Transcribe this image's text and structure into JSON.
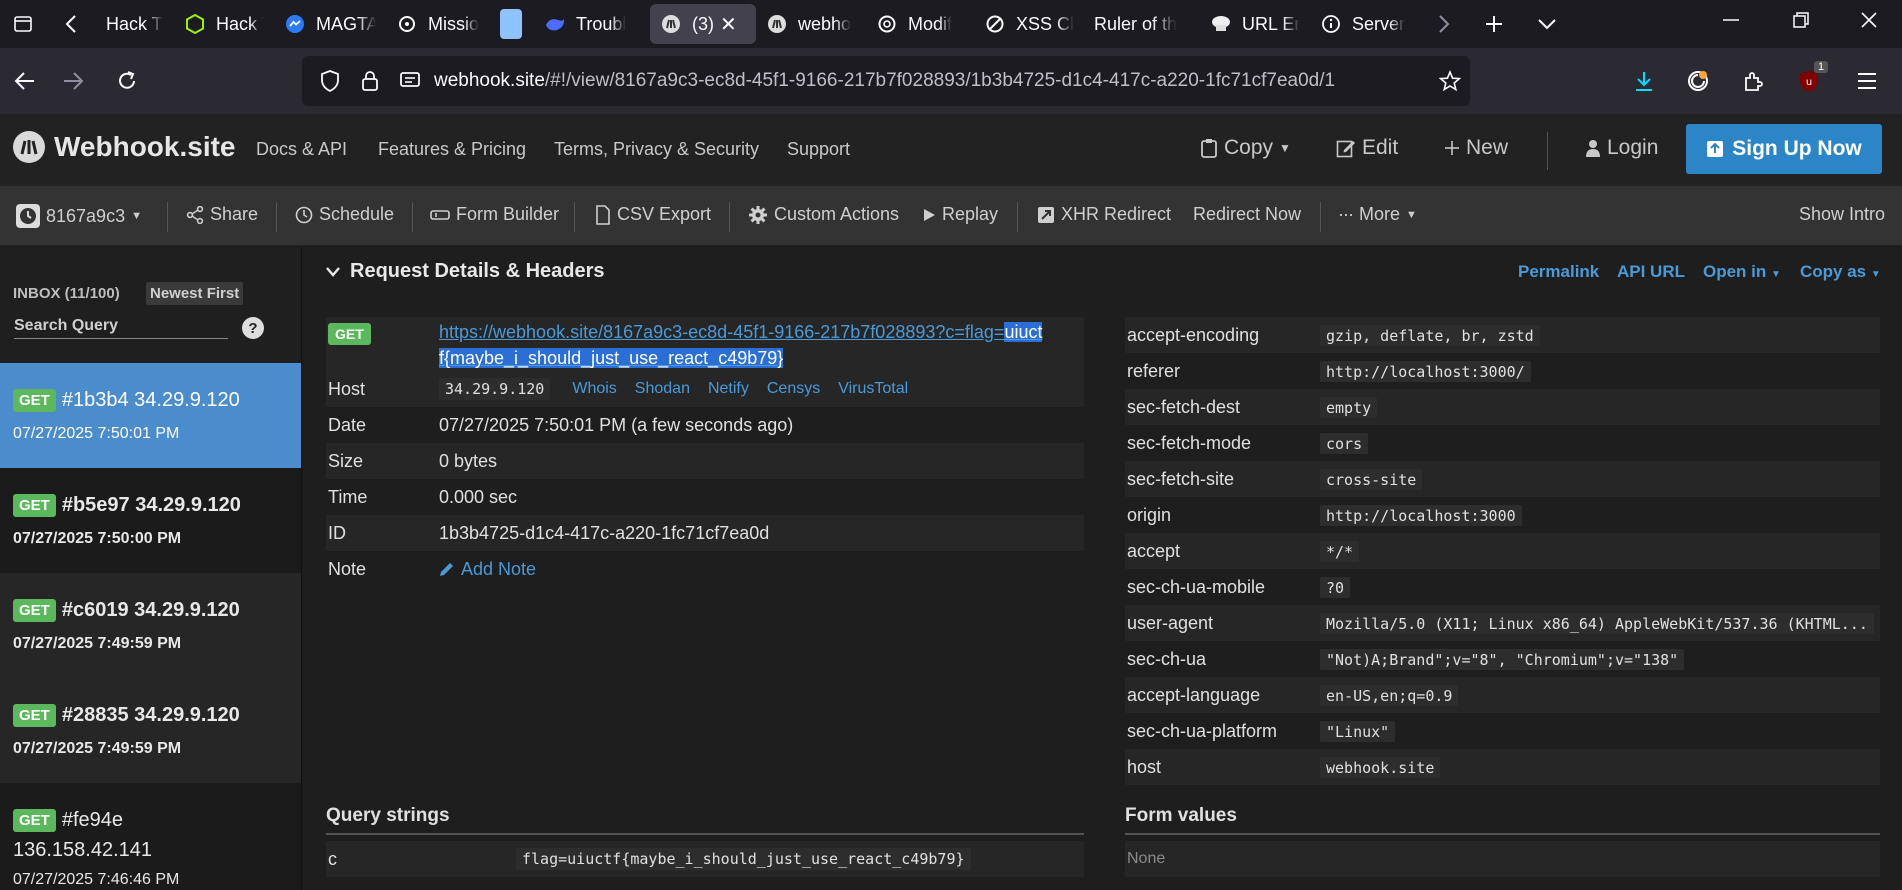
{
  "browser": {
    "tabs": [
      {
        "label": "Hack T",
        "icon": "hackthebox-icon"
      },
      {
        "label": "Hack T",
        "icon": "hackthebox-green-icon"
      },
      {
        "label": "MAGTA",
        "icon": "messenger-icon"
      },
      {
        "label": "Missio",
        "icon": "mission-icon"
      },
      {
        "label": "",
        "icon": "blank-page-icon"
      },
      {
        "label": "Troubl",
        "icon": "deepseek-icon"
      },
      {
        "label": "(3)",
        "icon": "webhook-icon"
      },
      {
        "label": "webho",
        "icon": "webhook-icon"
      },
      {
        "label": "Modif",
        "icon": "chatgpt-icon"
      },
      {
        "label": "XSS Cl",
        "icon": "xss-icon"
      },
      {
        "label": "Ruler of th",
        "icon": ""
      },
      {
        "label": "URL Er",
        "icon": "chef-hat-icon"
      },
      {
        "label": "Server",
        "icon": "info-circle-icon"
      }
    ],
    "url": {
      "domain": "webhook.site",
      "path": "/#!/view/8167a9c3-ec8d-45f1-9166-217b7f028893/1b3b4725-d1c4-417c-a220-1fc71cf7ea0d/1"
    },
    "extension_badge": "1",
    "accent_color": "#00ddff"
  },
  "header": {
    "brand": "Webhook.site",
    "links": [
      "Docs & API",
      "Features & Pricing",
      "Terms, Privacy & Security",
      "Support"
    ],
    "copy_label": "Copy",
    "edit_label": "Edit",
    "new_label": "New",
    "login_label": "Login",
    "signup_label": "Sign Up Now",
    "signup_color": "#2c85c6"
  },
  "toolbar": {
    "token": "8167a9c3",
    "share": "Share",
    "schedule": "Schedule",
    "form_builder": "Form Builder",
    "csv_export": "CSV Export",
    "custom_actions": "Custom Actions",
    "replay": "Replay",
    "xhr_redirect": "XHR Redirect",
    "redirect_now": "Redirect Now",
    "more": "More",
    "show_intro": "Show Intro"
  },
  "sidebar": {
    "inbox": "INBOX (11/100)",
    "sort": "Newest First",
    "search_placeholder": "Search Query",
    "help": "?",
    "requests": [
      {
        "method": "GET",
        "id_ip": "#1b3b4 34.29.9.120",
        "time": "07/27/2025 7:50:01 PM",
        "active": true
      },
      {
        "method": "GET",
        "id_ip": "#b5e97 34.29.9.120",
        "time": "07/27/2025 7:50:00 PM"
      },
      {
        "method": "GET",
        "id_ip": "#c6019 34.29.9.120",
        "time": "07/27/2025 7:49:59 PM"
      },
      {
        "method": "GET",
        "id_ip": "#28835 34.29.9.120",
        "time": "07/27/2025 7:49:59 PM"
      },
      {
        "method": "GET",
        "id": "#fe94e",
        "ip": "136.158.42.141",
        "time": "07/27/2025 7:46:46 PM"
      }
    ]
  },
  "details": {
    "title": "Request Details & Headers",
    "actions": [
      "Permalink",
      "API URL",
      "Open in",
      "Copy as"
    ],
    "method": "GET",
    "url_part1": "https://webhook.site/8167a9c3-ec8d-45f1-9166-217b7f028893?c=flag=",
    "url_hl1": "uiuct",
    "url_hl2": "f{maybe_i_should_just_use_react_c49b79}",
    "rows": {
      "host_label": "Host",
      "host": "34.29.9.120",
      "host_links": [
        "Whois",
        "Shodan",
        "Netify",
        "Censys",
        "VirusTotal"
      ],
      "date_label": "Date",
      "date": "07/27/2025 7:50:01 PM (a few seconds ago)",
      "size_label": "Size",
      "size": "0 bytes",
      "time_label": "Time",
      "time": "0.000 sec",
      "id_label": "ID",
      "id": "1b3b4725-d1c4-417c-a220-1fc71cf7ea0d",
      "note_label": "Note",
      "note": "Add Note"
    },
    "headers": [
      {
        "k": "accept-encoding",
        "v": "gzip, deflate, br, zstd"
      },
      {
        "k": "referer",
        "v": "http://localhost:3000/"
      },
      {
        "k": "sec-fetch-dest",
        "v": "empty"
      },
      {
        "k": "sec-fetch-mode",
        "v": "cors"
      },
      {
        "k": "sec-fetch-site",
        "v": "cross-site"
      },
      {
        "k": "origin",
        "v": "http://localhost:3000"
      },
      {
        "k": "accept",
        "v": "*/*"
      },
      {
        "k": "sec-ch-ua-mobile",
        "v": "?0"
      },
      {
        "k": "user-agent",
        "v": "Mozilla/5.0 (X11; Linux x86_64) AppleWebKit/537.36 (KHTML..."
      },
      {
        "k": "sec-ch-ua",
        "v": "\"Not)A;Brand\";v=\"8\", \"Chromium\";v=\"138\""
      },
      {
        "k": "accept-language",
        "v": "en-US,en;q=0.9"
      },
      {
        "k": "sec-ch-ua-platform",
        "v": "\"Linux\""
      },
      {
        "k": "host",
        "v": "webhook.site"
      }
    ],
    "query_title": "Query strings",
    "query": [
      {
        "k": "c",
        "v": "flag=uiuctf{maybe_i_should_just_use_react_c49b79}"
      }
    ],
    "form_title": "Form values",
    "form_empty": "None"
  }
}
